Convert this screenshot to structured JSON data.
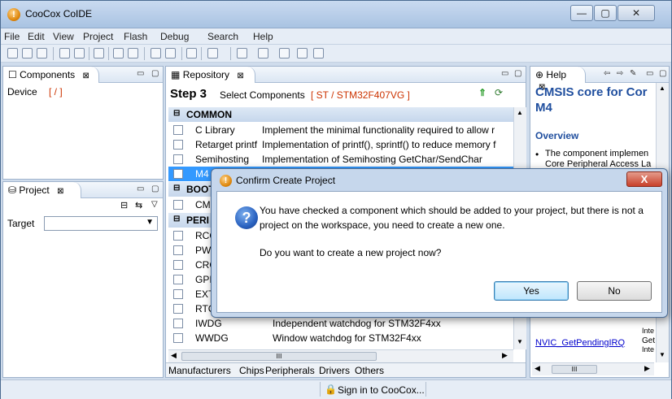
{
  "window": {
    "title": "CooCox CoIDE"
  },
  "menu": [
    "File",
    "Edit",
    "View",
    "Project",
    "Flash",
    "Debug",
    "Search",
    "Help"
  ],
  "components_pane": {
    "tab": "Components",
    "device_label": "Device",
    "device_value": "[ / ]"
  },
  "project_pane": {
    "tab": "Project",
    "target_label": "Target"
  },
  "repository": {
    "tab": "Repository",
    "step": "Step 3",
    "step_text": "Select Components",
    "chip": "[ ST / STM32F407VG ]",
    "groups": {
      "common": "COMMON",
      "boot": "BOOT",
      "peri": "PERI"
    },
    "rows": [
      {
        "name": "C Library",
        "desc": "Implement the minimal functionality required to allow r"
      },
      {
        "name": "Retarget printf",
        "desc": "Implementation of printf(), sprintf() to reduce memory f"
      },
      {
        "name": "Semihosting",
        "desc": "Implementation of Semihosting GetChar/SendChar"
      },
      {
        "name": "M4",
        "desc": ""
      },
      {
        "name": "CMS",
        "desc": ""
      },
      {
        "name": "RCC",
        "desc": ""
      },
      {
        "name": "PWF",
        "desc": ""
      },
      {
        "name": "CRC",
        "desc": ""
      },
      {
        "name": "GPIC",
        "desc": ""
      },
      {
        "name": "EXTI",
        "desc": ""
      },
      {
        "name": "RTC",
        "desc": ""
      },
      {
        "name": "IWDG",
        "desc": "Independent watchdog for STM32F4xx"
      },
      {
        "name": "WWDG",
        "desc": "Window watchdog for STM32F4xx"
      }
    ],
    "bottom_tabs": [
      "Manufacturers",
      "Chips",
      "Peripherals",
      "Drivers",
      "Others"
    ],
    "hscroll_mark": "III"
  },
  "help": {
    "tab": "Help",
    "title_line1": "CMSIS core for Cor",
    "title_line2": "M4",
    "overview": "Overview",
    "bullet_line1": "The component implemen",
    "bullet_line2": "Core Peripheral Access La",
    "link": "NVIC_GetPendingIRQ",
    "link_desc1": "Get",
    "link_desc2": "Inte",
    "upper_desc": "Inte",
    "hscroll_mark": "III"
  },
  "dialog": {
    "title": "Confirm Create Project",
    "message_line1": "You have checked a component which should be added to your project, but there is not a",
    "message_line2": "project on the workspace, you need to create a new one.",
    "question": "Do you want to create a new project now?",
    "yes": "Yes",
    "no": "No",
    "close": "X"
  },
  "status": {
    "sign_in": "Sign in to CooCox..."
  },
  "colors": {
    "selection": "#3399ff",
    "link": "#0000cc",
    "chip_red": "#cc3300",
    "help_title": "#1f4e9e"
  }
}
